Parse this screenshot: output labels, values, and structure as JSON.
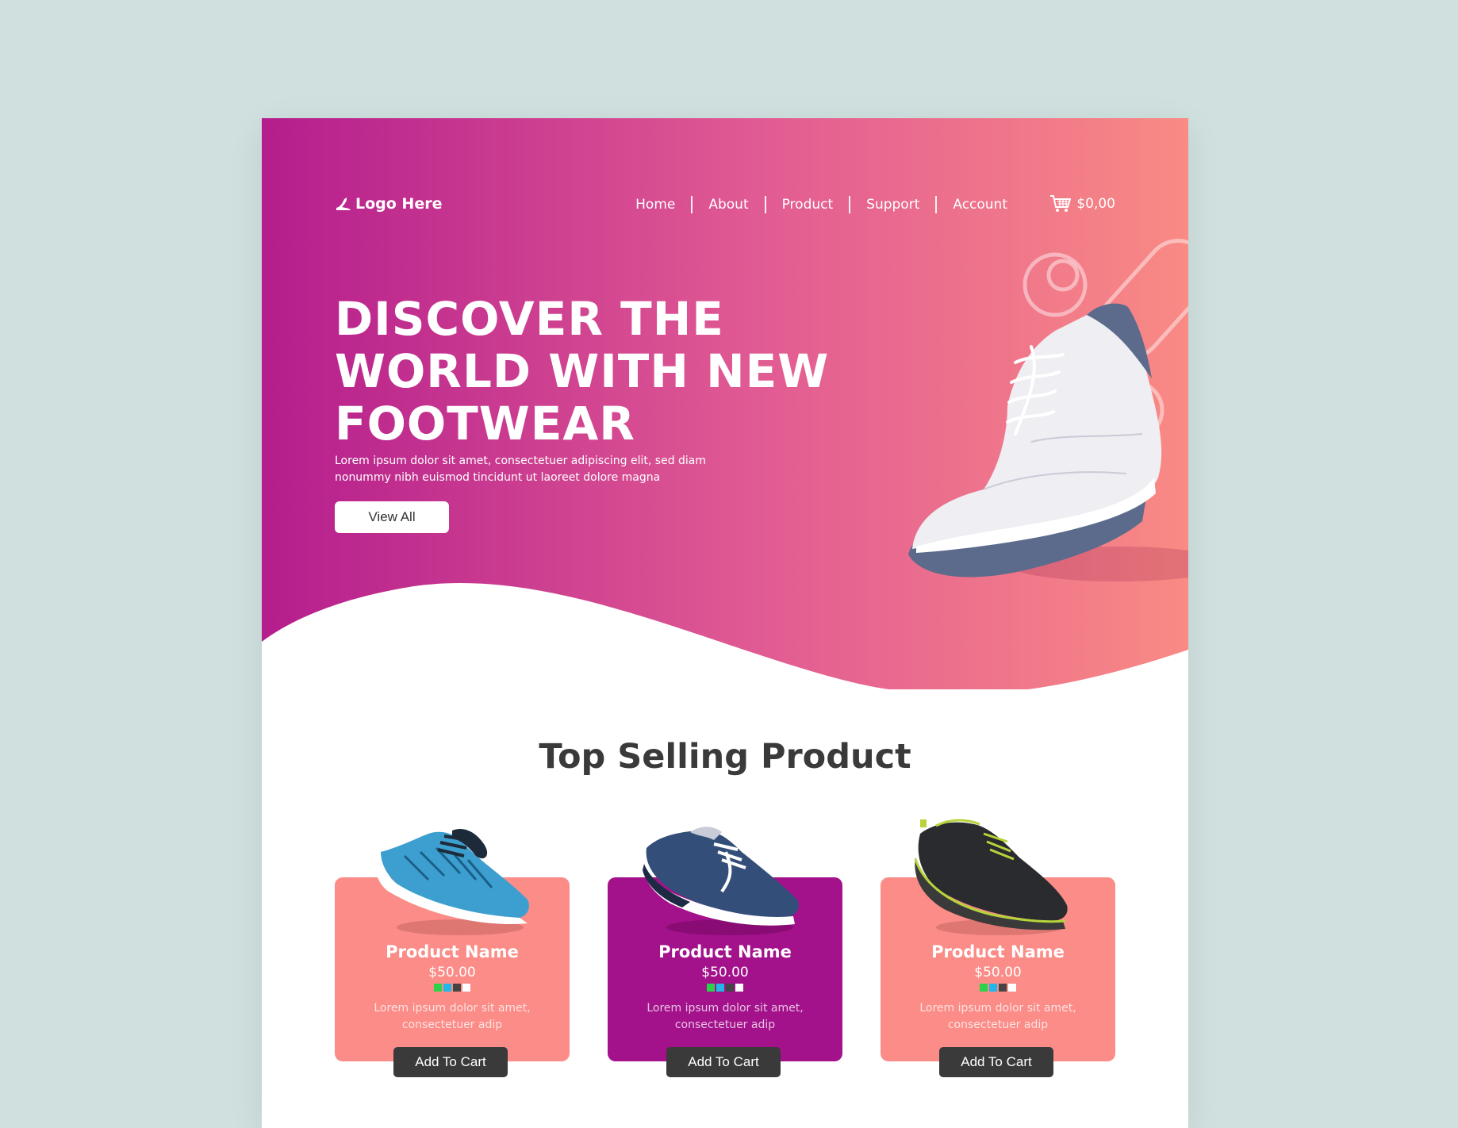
{
  "colors": {
    "hero_gradient_start": "#b41d8d",
    "hero_gradient_end": "#f98a84",
    "card_coral": "#fb8c87",
    "card_purple": "#a3118b",
    "button_dark": "#3a3a3a",
    "background": "#cfe0de"
  },
  "header": {
    "logo_text": "Logo Here",
    "logo_icon": "high-heel-icon",
    "nav": [
      "Home",
      "About",
      "Product",
      "Support",
      "Account"
    ],
    "cart_icon": "shopping-cart-icon",
    "cart_total": "$0,00"
  },
  "hero": {
    "headline": [
      "DISCOVER THE",
      "WORLD WITH NEW",
      "FOOTWEAR"
    ],
    "description": "Lorem ipsum dolor sit amet, consectetuer adipiscing elit, sed diam nonummy nibh euismod tincidunt ut laoreet dolore magna",
    "cta_label": "View All"
  },
  "products_section": {
    "title": "Top Selling Product",
    "products": [
      {
        "name": "Product Name",
        "price": "$50.00",
        "swatches": [
          "#2bd34a",
          "#22b7e8",
          "#444444",
          "#ffffff"
        ],
        "description": "Lorem ipsum dolor sit amet, consectetuer adip",
        "button_label": "Add To Cart",
        "card_color": "#fb8c87"
      },
      {
        "name": "Product Name",
        "price": "$50.00",
        "swatches": [
          "#2bd34a",
          "#22b7e8",
          "#444444",
          "#ffffff"
        ],
        "description": "Lorem ipsum dolor sit amet, consectetuer adip",
        "button_label": "Add To Cart",
        "card_color": "#a3118b"
      },
      {
        "name": "Product Name",
        "price": "$50.00",
        "swatches": [
          "#2bd34a",
          "#22b7e8",
          "#444444",
          "#ffffff"
        ],
        "description": "Lorem ipsum dolor sit amet, consectetuer adip",
        "button_label": "Add To Cart",
        "card_color": "#fb8c87"
      }
    ]
  }
}
